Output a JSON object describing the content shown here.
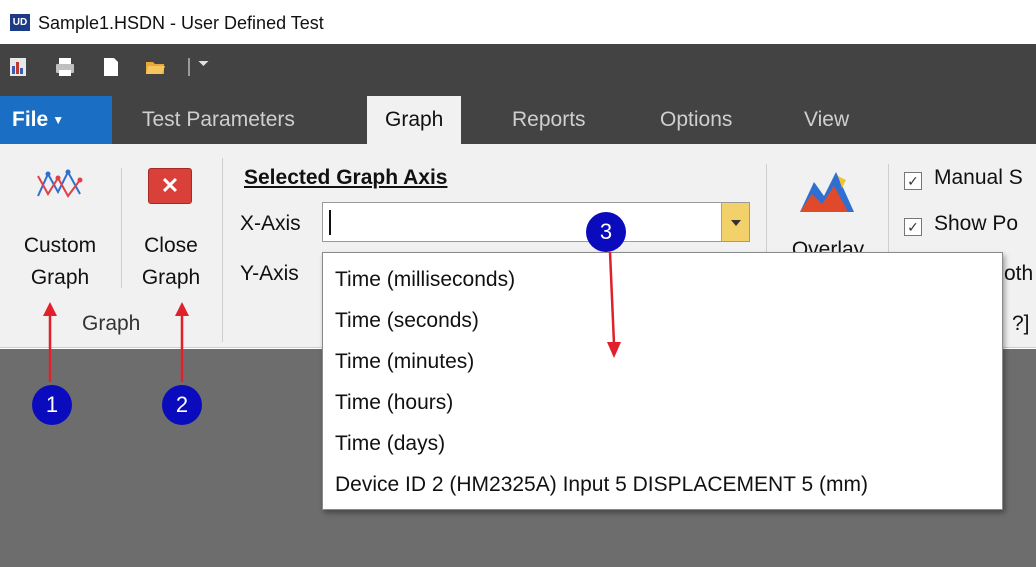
{
  "window": {
    "title": "Sample1.HSDN - User Defined Test",
    "icon_text": "UD"
  },
  "qat": {
    "icons": [
      "report-icon",
      "print-icon",
      "new-document-icon",
      "open-folder-icon"
    ],
    "more": "⏷"
  },
  "tabs": {
    "file": "File",
    "items": [
      {
        "label": "Test Parameters",
        "active": false
      },
      {
        "label": "Graph",
        "active": true
      },
      {
        "label": "Reports",
        "active": false
      },
      {
        "label": "Options",
        "active": false
      },
      {
        "label": "View",
        "active": false
      }
    ]
  },
  "ribbon": {
    "graph_group": {
      "custom_graph": [
        "Custom",
        "Graph"
      ],
      "close_graph": [
        "Close",
        "Graph"
      ],
      "label": "Graph"
    },
    "axis_group": {
      "heading": "Selected Graph Axis",
      "x_label": "X-Axis",
      "x_value": "",
      "y_label": "Y-Axis"
    },
    "overlay_label": "Overlay",
    "checks": [
      "Manual S",
      "Show Po"
    ],
    "partial_texts": [
      "oth",
      "?]"
    ]
  },
  "dropdown": {
    "items": [
      "Time (milliseconds)",
      "Time (seconds)",
      "Time (minutes)",
      "Time (hours)",
      "Time (days)",
      "Device ID 2 (HM2325A) Input 5 DISPLACEMENT 5 (mm)"
    ]
  },
  "callouts": [
    "1",
    "2",
    "3"
  ],
  "colors": {
    "qat_bg": "#434343",
    "file_blue": "#1a6ec4",
    "callout_blue": "#0a0bbd",
    "arrow_red": "#e0202a",
    "canvas": "#6d6d6d"
  }
}
